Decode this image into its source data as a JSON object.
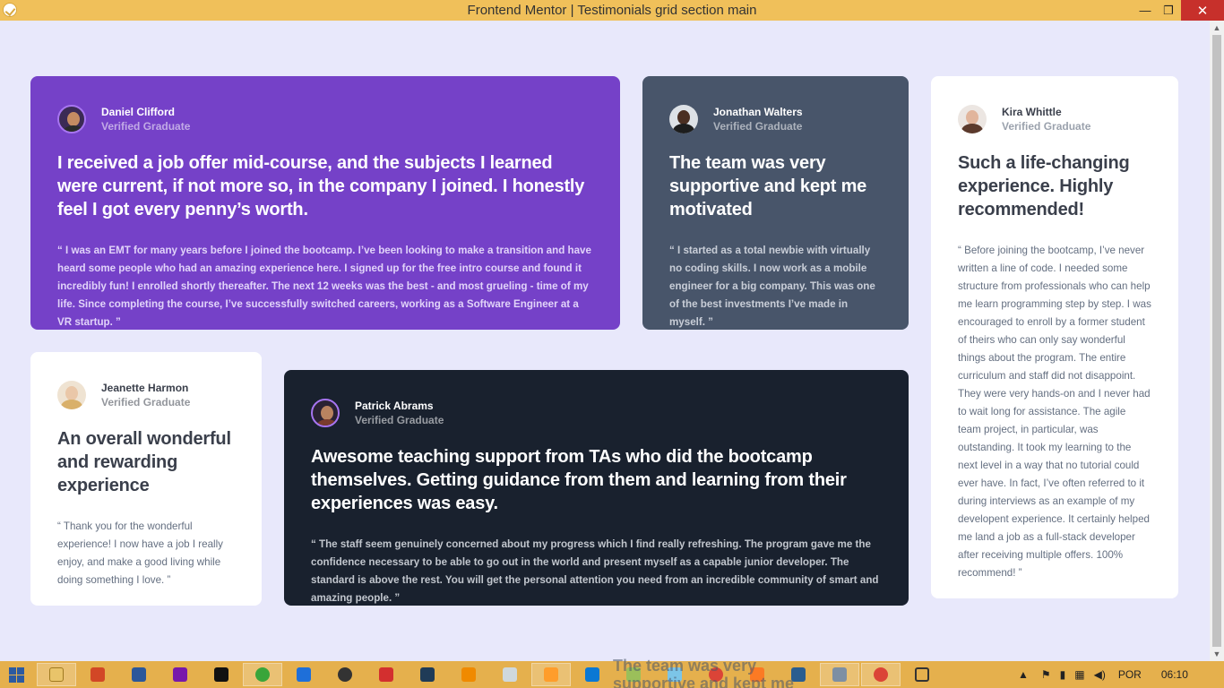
{
  "window": {
    "title": "Frontend Mentor | Testimonials grid section main",
    "minimize": "—",
    "maximize": "❐",
    "close": "✕"
  },
  "testimonials": [
    {
      "name": "Daniel Clifford",
      "role": "Verified Graduate",
      "headline": "I received a job offer mid-course, and the subjects I learned were current, if not more so, in the company I joined. I honestly feel I got every penny’s worth.",
      "quote": "“ I was an EMT for many years before I joined the bootcamp. I’ve been looking to make a transition and have heard some people who had an amazing experience here. I signed up for the free intro course and found it incredibly fun! I enrolled shortly thereafter. The next 12 weeks was the best - and most grueling - time of my life. Since completing the course, I’ve successfully switched careers, working as a Software Engineer at a VR startup. ”"
    },
    {
      "name": "Jonathan Walters",
      "role": "Verified Graduate",
      "headline": "The team was very supportive and kept me motivated",
      "quote": "“ I started as a total newbie with virtually no coding skills. I now work as a mobile engineer for a big company. This was one of the best investments I’ve made in myself. ”"
    },
    {
      "name": "Kira Whittle",
      "role": "Verified Graduate",
      "headline": "Such a life-changing experience. Highly recommended!",
      "quote": "“ Before joining the bootcamp, I’ve never written a line of code. I needed some structure from professionals who can help me learn programming step by step. I was encouraged to enroll by a former student of theirs who can only say wonderful things about the program. The entire curriculum and staff did not disappoint. They were very hands-on and I never had to wait long for assistance. The agile team project, in particular, was outstanding. It took my learning to the next level in a way that no tutorial could ever have. In fact, I’ve often referred to it during interviews as an example of my developent experience. It certainly helped me land a job as a full-stack developer after receiving multiple offers. 100% recommend! ”"
    },
    {
      "name": "Jeanette Harmon",
      "role": "Verified Graduate",
      "headline": "An overall wonderful and rewarding experience",
      "quote": "“ Thank you for the wonderful experience! I now have a job I really enjoy, and make a good living while doing something I love. ”"
    },
    {
      "name": "Patrick Abrams",
      "role": "Verified Graduate",
      "headline": "Awesome teaching support from TAs who did the bootcamp themselves. Getting guidance from them and learning from their experiences was easy.",
      "quote": "“ The staff seem genuinely concerned about my progress which I find really refreshing. The program gave me the confidence necessary to be able to go out in the world and present myself as a capable junior developer. The standard is above the rest. You will get the personal attention you need from an incredible community of smart and amazing people. ”"
    }
  ],
  "taskbar": {
    "ghost_text": "The team was very supportive and kept me motivated",
    "language": "POR",
    "clock": "06:10"
  },
  "colors": {
    "background": "#e8e8fb",
    "purple": "#7541c8",
    "grayish_blue": "#48556a",
    "dark": "#19212e",
    "titlebar": "#f0c05a",
    "taskbar": "#e5b04d"
  }
}
